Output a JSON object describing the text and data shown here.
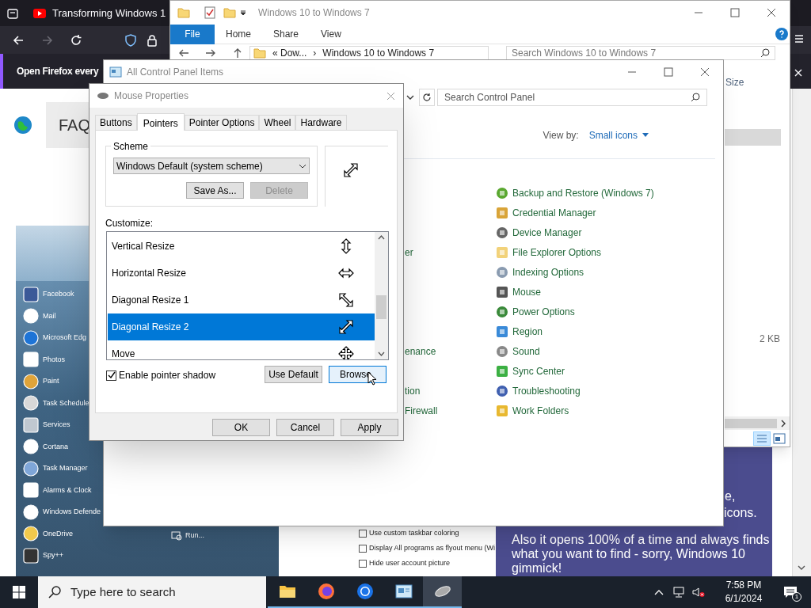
{
  "browser": {
    "tab": {
      "title": "Transforming Windows 1"
    },
    "notification": "Open Firefox every",
    "page": {
      "heading": "FAQ",
      "start_menu": {
        "items": [
          {
            "label": "Facebook"
          },
          {
            "label": "Mail"
          },
          {
            "label": "Microsoft Edg"
          },
          {
            "label": "Photos"
          },
          {
            "label": "Paint"
          },
          {
            "label": "Task Schedule"
          },
          {
            "label": "Services"
          },
          {
            "label": "Cortana"
          },
          {
            "label": "Task Manager"
          },
          {
            "label": "Alarms & Clock"
          },
          {
            "label": "Windows Defende"
          },
          {
            "label": "OneDrive"
          },
          {
            "label": "Spy++"
          }
        ],
        "run": "Run..."
      },
      "options": [
        {
          "label": "Use custom taskbar coloring",
          "checked": false
        },
        {
          "label": "Display All programs as flyout menu (Wi",
          "checked": false
        },
        {
          "label": "Hide user account picture",
          "checked": false
        }
      ],
      "promo": {
        "fragments": [
          "e,",
          "icons."
        ],
        "text": "Also it opens 100% of a time and always finds what you want to find - sorry, Windows 10 gimmick!"
      }
    }
  },
  "explorer": {
    "title": "Windows 10 to Windows 7",
    "file_menu": "File",
    "ribbon_tabs": [
      "Home",
      "Share",
      "View"
    ],
    "address": {
      "prefix": "«",
      "separator": "›",
      "crumbs": [
        "Dow...",
        "Windows 10 to Windows 7"
      ]
    },
    "search": {
      "placeholder": "Search Windows 10 to Windows 7"
    },
    "column": "Size",
    "size_value": "2 KB"
  },
  "control_panel": {
    "title": "All Control Panel Items",
    "search": {
      "placeholder": "Search Control Panel"
    },
    "view_by": {
      "label": "View by:",
      "value": "Small icons"
    },
    "left_fragments": [
      "er",
      "enance",
      "tion",
      "Firewall"
    ],
    "items": [
      "Backup and Restore (Windows 7)",
      "Credential Manager",
      "Device Manager",
      "File Explorer Options",
      "Indexing Options",
      "Mouse",
      "Power Options",
      "Region",
      "Sound",
      "Sync Center",
      "Troubleshooting",
      "Work Folders"
    ]
  },
  "mouse_properties": {
    "title": "Mouse Properties",
    "tabs": [
      {
        "label": "Buttons",
        "selected": false
      },
      {
        "label": "Pointers",
        "selected": true
      },
      {
        "label": "Pointer Options",
        "selected": false
      },
      {
        "label": "Wheel",
        "selected": false
      },
      {
        "label": "Hardware",
        "selected": false
      }
    ],
    "scheme": {
      "label": "Scheme",
      "value": "Windows Default (system scheme)"
    },
    "scheme_buttons": [
      {
        "label": "Save As...",
        "disabled": false
      },
      {
        "label": "Delete",
        "disabled": true
      }
    ],
    "customize_label": "Customize:",
    "pointers": [
      {
        "name": "Vertical Resize",
        "kind": "vertical",
        "selected": false
      },
      {
        "name": "Horizontal Resize",
        "kind": "horizontal",
        "selected": false
      },
      {
        "name": "Diagonal Resize 1",
        "kind": "diagonal1",
        "selected": false
      },
      {
        "name": "Diagonal Resize 2",
        "kind": "diagonal2",
        "selected": true
      },
      {
        "name": "Move",
        "kind": "move",
        "selected": false
      }
    ],
    "pointer_shadow": {
      "label": "Enable pointer shadow",
      "checked": true
    },
    "list_buttons": [
      "Use Default",
      "Browse"
    ],
    "dialog_buttons": [
      "OK",
      "Cancel",
      "Apply"
    ]
  },
  "taskbar": {
    "search": {
      "placeholder": "Type here to search"
    },
    "apps": [
      {
        "kind": "folder",
        "selected": false
      },
      {
        "kind": "firefox",
        "selected": false
      },
      {
        "kind": "chrome",
        "selected": false
      },
      {
        "kind": "panel",
        "selected": false
      },
      {
        "kind": "mouse",
        "selected": true
      }
    ],
    "clock": {
      "time": "7:58 PM",
      "date": "6/1/2024"
    },
    "notifications": "1"
  }
}
